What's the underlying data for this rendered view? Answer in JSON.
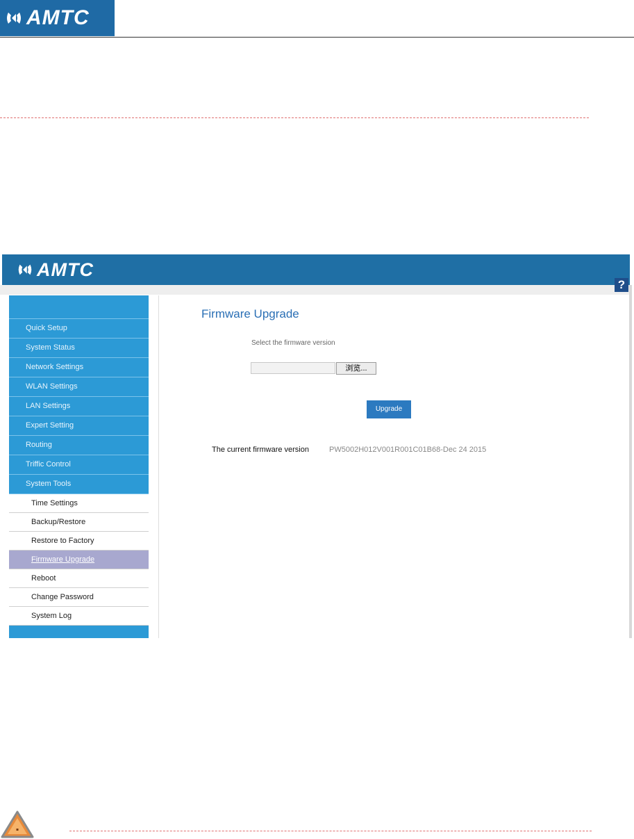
{
  "doc": {
    "brand": "AMTC"
  },
  "app": {
    "brand": "AMTC",
    "sidebar": {
      "items": [
        {
          "label": "Quick Setup"
        },
        {
          "label": "System Status"
        },
        {
          "label": "Network Settings"
        },
        {
          "label": "WLAN Settings"
        },
        {
          "label": "LAN Settings"
        },
        {
          "label": "Expert Setting"
        },
        {
          "label": "Routing"
        },
        {
          "label": "Triffic Control"
        },
        {
          "label": "System Tools"
        }
      ],
      "subitems": [
        {
          "label": "Time Settings"
        },
        {
          "label": "Backup/Restore"
        },
        {
          "label": "Restore to Factory"
        },
        {
          "label": "Firmware Upgrade"
        },
        {
          "label": "Reboot"
        },
        {
          "label": "Change Password"
        },
        {
          "label": "System Log"
        }
      ],
      "active_subitem": "Firmware Upgrade"
    },
    "main": {
      "help": "?",
      "title": "Firmware Upgrade",
      "select_label": "Select the firmware version",
      "file_value": "",
      "browse_label": "浏览...",
      "upgrade_label": "Upgrade",
      "current_label": "The current firmware version",
      "current_value": "PW5002H012V001R001C01B68-Dec 24 2015"
    }
  },
  "colors": {
    "header_blue": "#1f6fa5",
    "sidebar_blue": "#2c9ad6",
    "active_item": "#a8a8cf",
    "title_blue": "#2a6fb5",
    "button_blue": "#2c7ac0",
    "dash_red": "#e07070",
    "caution_orange": "#e88a3a"
  },
  "icons": [
    "logo-icon",
    "help-icon",
    "caution-icon"
  ]
}
